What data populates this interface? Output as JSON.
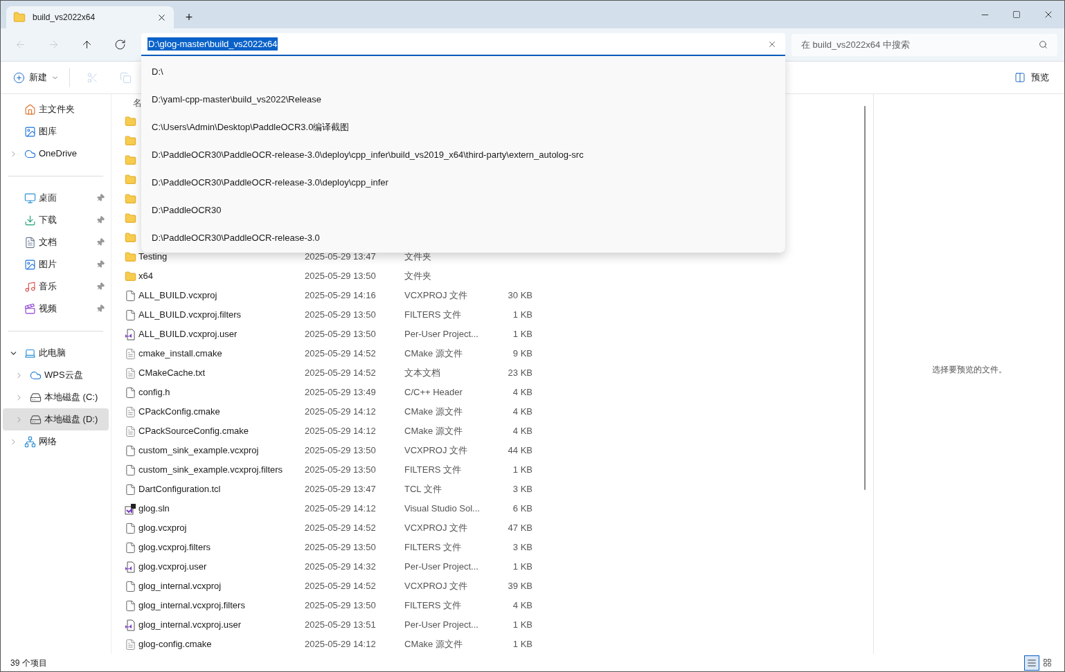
{
  "window": {
    "tab_title": "build_vs2022x64",
    "new_tab": "+"
  },
  "nav": [
    {
      "kind": "back",
      "disabled": true
    },
    {
      "kind": "forward",
      "disabled": true
    },
    {
      "kind": "up",
      "disabled": false
    },
    {
      "kind": "refresh",
      "disabled": false
    }
  ],
  "address": {
    "value": "D:\\glog-master\\build_vs2022x64",
    "suggestions": [
      "D:\\",
      "D:\\yaml-cpp-master\\build_vs2022\\Release",
      "C:\\Users\\Admin\\Desktop\\PaddleOCR3.0编译截图",
      "D:\\PaddleOCR30\\PaddleOCR-release-3.0\\deploy\\cpp_infer\\build_vs2019_x64\\third-party\\extern_autolog-src",
      "D:\\PaddleOCR30\\PaddleOCR-release-3.0\\deploy\\cpp_infer",
      "D:\\PaddleOCR30",
      "D:\\PaddleOCR30\\PaddleOCR-release-3.0"
    ]
  },
  "search": {
    "placeholder": "在 build_vs2022x64 中搜索"
  },
  "toolbar": {
    "new_label": "新建",
    "tools": [
      {
        "kind": "cut",
        "disabled": true
      },
      {
        "kind": "copy",
        "disabled": true
      }
    ],
    "preview_label": "预览"
  },
  "sidebar": [
    [
      {
        "label": "主文件夹",
        "kind": "home",
        "pinned": false,
        "expandable": false,
        "nested": false,
        "selected": false
      },
      {
        "label": "图库",
        "kind": "gallery",
        "pinned": false,
        "expandable": false,
        "nested": false,
        "selected": false
      },
      {
        "label": "OneDrive",
        "kind": "cloud",
        "pinned": false,
        "expandable": true,
        "expanded": false,
        "nested": false,
        "selected": false
      }
    ],
    [
      {
        "label": "桌面",
        "kind": "desktop",
        "pinned": true,
        "expandable": false,
        "nested": false,
        "selected": false
      },
      {
        "label": "下载",
        "kind": "download",
        "pinned": true,
        "expandable": false,
        "nested": false,
        "selected": false
      },
      {
        "label": "文档",
        "kind": "document",
        "pinned": true,
        "expandable": false,
        "nested": false,
        "selected": false
      },
      {
        "label": "图片",
        "kind": "gallery",
        "pinned": true,
        "expandable": false,
        "nested": false,
        "selected": false
      },
      {
        "label": "音乐",
        "kind": "music",
        "pinned": true,
        "expandable": false,
        "nested": false,
        "selected": false
      },
      {
        "label": "视频",
        "kind": "video",
        "pinned": true,
        "expandable": false,
        "nested": false,
        "selected": false
      }
    ],
    [
      {
        "label": "此电脑",
        "kind": "pc",
        "pinned": false,
        "expandable": true,
        "expanded": true,
        "nested": false,
        "selected": false
      },
      {
        "label": "WPS云盘",
        "kind": "cloud",
        "pinned": false,
        "expandable": true,
        "expanded": false,
        "nested": true,
        "selected": false
      },
      {
        "label": "本地磁盘 (C:)",
        "kind": "drive",
        "pinned": false,
        "expandable": true,
        "expanded": false,
        "nested": true,
        "selected": false
      },
      {
        "label": "本地磁盘 (D:)",
        "kind": "drive",
        "pinned": false,
        "expandable": true,
        "expanded": false,
        "nested": true,
        "selected": true
      },
      {
        "label": "网络",
        "kind": "network",
        "pinned": false,
        "expandable": true,
        "expanded": false,
        "nested": false,
        "selected": false
      }
    ]
  ],
  "file_list": {
    "header": "名",
    "rows": [
      {
        "kind": "folder"
      },
      {
        "kind": "folder"
      },
      {
        "kind": "folder"
      },
      {
        "kind": "folder"
      },
      {
        "kind": "folder"
      },
      {
        "kind": "folder"
      },
      {
        "kind": "folder"
      },
      {
        "name": "Testing",
        "modified": "2025-05-29 13:47",
        "type": "文件夹",
        "kind": "folder"
      },
      {
        "name": "x64",
        "modified": "2025-05-29 13:50",
        "type": "文件夹",
        "kind": "folder"
      },
      {
        "name": "ALL_BUILD.vcxproj",
        "modified": "2025-05-29 14:16",
        "type": "VCXPROJ 文件",
        "size": "30 KB",
        "kind": "file"
      },
      {
        "name": "ALL_BUILD.vcxproj.filters",
        "modified": "2025-05-29 13:50",
        "type": "FILTERS 文件",
        "size": "1 KB",
        "kind": "file"
      },
      {
        "name": "ALL_BUILD.vcxproj.user",
        "modified": "2025-05-29 13:50",
        "type": "Per-User Project...",
        "size": "1 KB",
        "kind": "vs"
      },
      {
        "name": "cmake_install.cmake",
        "modified": "2025-05-29 14:52",
        "type": "CMake 源文件",
        "size": "9 KB",
        "kind": "text"
      },
      {
        "name": "CMakeCache.txt",
        "modified": "2025-05-29 14:52",
        "type": "文本文档",
        "size": "23 KB",
        "kind": "text"
      },
      {
        "name": "config.h",
        "modified": "2025-05-29 13:49",
        "type": "C/C++ Header",
        "size": "4 KB",
        "kind": "file"
      },
      {
        "name": "CPackConfig.cmake",
        "modified": "2025-05-29 14:12",
        "type": "CMake 源文件",
        "size": "4 KB",
        "kind": "text"
      },
      {
        "name": "CPackSourceConfig.cmake",
        "modified": "2025-05-29 14:12",
        "type": "CMake 源文件",
        "size": "4 KB",
        "kind": "text"
      },
      {
        "name": "custom_sink_example.vcxproj",
        "modified": "2025-05-29 13:50",
        "type": "VCXPROJ 文件",
        "size": "44 KB",
        "kind": "file"
      },
      {
        "name": "custom_sink_example.vcxproj.filters",
        "modified": "2025-05-29 13:50",
        "type": "FILTERS 文件",
        "size": "1 KB",
        "kind": "file"
      },
      {
        "name": "DartConfiguration.tcl",
        "modified": "2025-05-29 13:47",
        "type": "TCL 文件",
        "size": "3 KB",
        "kind": "file"
      },
      {
        "name": "glog.sln",
        "modified": "2025-05-29 14:12",
        "type": "Visual Studio Sol...",
        "size": "6 KB",
        "kind": "sln"
      },
      {
        "name": "glog.vcxproj",
        "modified": "2025-05-29 14:52",
        "type": "VCXPROJ 文件",
        "size": "47 KB",
        "kind": "file"
      },
      {
        "name": "glog.vcxproj.filters",
        "modified": "2025-05-29 13:50",
        "type": "FILTERS 文件",
        "size": "3 KB",
        "kind": "file"
      },
      {
        "name": "glog.vcxproj.user",
        "modified": "2025-05-29 14:32",
        "type": "Per-User Project...",
        "size": "1 KB",
        "kind": "vs"
      },
      {
        "name": "glog_internal.vcxproj",
        "modified": "2025-05-29 14:52",
        "type": "VCXPROJ 文件",
        "size": "39 KB",
        "kind": "file"
      },
      {
        "name": "glog_internal.vcxproj.filters",
        "modified": "2025-05-29 13:50",
        "type": "FILTERS 文件",
        "size": "4 KB",
        "kind": "file"
      },
      {
        "name": "glog_internal.vcxproj.user",
        "modified": "2025-05-29 13:51",
        "type": "Per-User Project...",
        "size": "1 KB",
        "kind": "vs"
      },
      {
        "name": "glog-config.cmake",
        "modified": "2025-05-29 14:12",
        "type": "CMake 源文件",
        "size": "1 KB",
        "kind": "text"
      }
    ]
  },
  "preview": {
    "message": "选择要预览的文件。"
  },
  "status_bar": {
    "count": "39 个项目",
    "views": [
      {
        "kind": "details",
        "selected": true
      },
      {
        "kind": "tiles",
        "selected": false
      }
    ]
  }
}
